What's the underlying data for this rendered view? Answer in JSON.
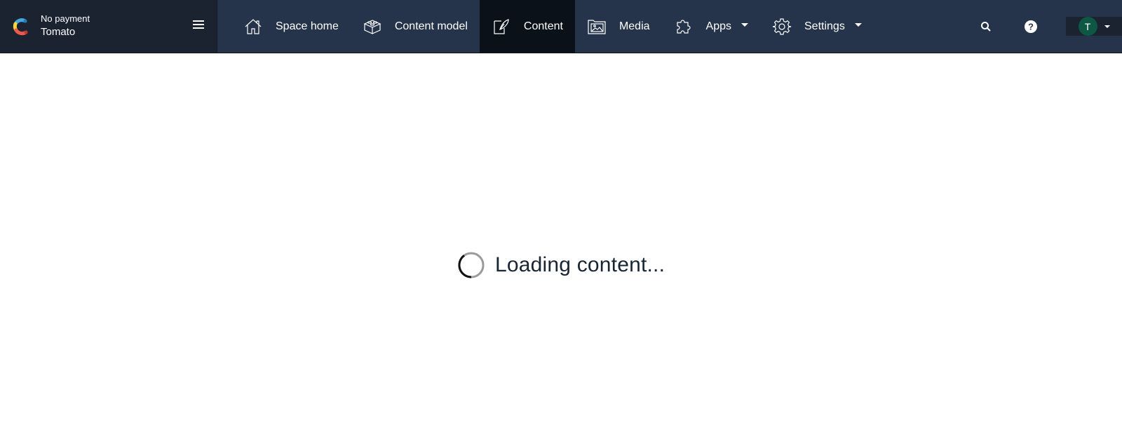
{
  "space": {
    "environment_label": "No payment",
    "name": "Tomato"
  },
  "nav": {
    "items": [
      {
        "label": "Space home",
        "icon": "home-icon"
      },
      {
        "label": "Content model",
        "icon": "lego-block-icon"
      },
      {
        "label": "Content",
        "icon": "edit-content-icon",
        "active": true
      },
      {
        "label": "Media",
        "icon": "media-folder-icon"
      },
      {
        "label": "Apps",
        "icon": "puzzle-icon",
        "dropdown": true
      },
      {
        "label": "Settings",
        "icon": "gear-icon",
        "dropdown": true
      }
    ]
  },
  "tools": {
    "search_icon": "search-icon",
    "help_icon": "help-icon"
  },
  "account": {
    "avatar_initial": "T",
    "avatar_color": "#0e5745"
  },
  "main": {
    "loading_text": "Loading content..."
  },
  "colors": {
    "topbar": "#25344a",
    "space_panel": "#1b2331",
    "active_tab": "#0b1119",
    "text_dark": "#192532"
  }
}
